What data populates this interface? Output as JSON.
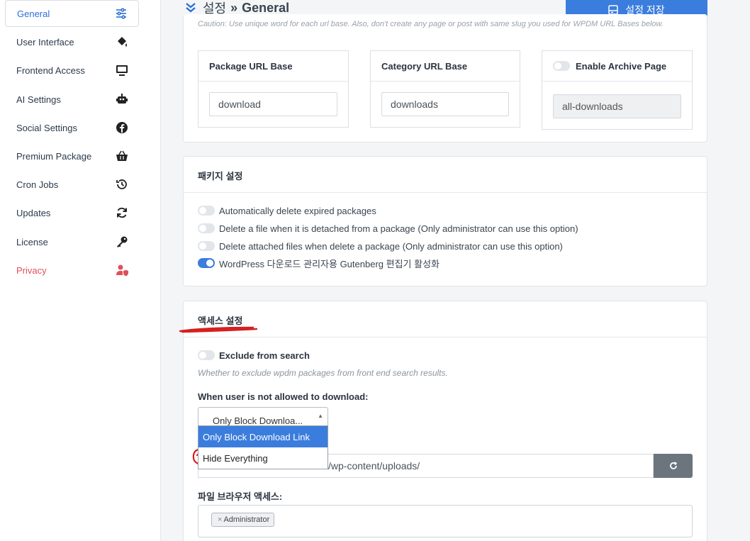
{
  "sidebar": {
    "items": [
      {
        "label": "General",
        "icon": "sliders-icon"
      },
      {
        "label": "User Interface",
        "icon": "paint-bucket-icon"
      },
      {
        "label": "Frontend Access",
        "icon": "monitor-icon"
      },
      {
        "label": "AI Settings",
        "icon": "robot-icon"
      },
      {
        "label": "Social Settings",
        "icon": "facebook-icon"
      },
      {
        "label": "Premium Package",
        "icon": "basket-icon"
      },
      {
        "label": "Cron Jobs",
        "icon": "history-icon"
      },
      {
        "label": "Updates",
        "icon": "sync-icon"
      },
      {
        "label": "License",
        "icon": "key-icon"
      },
      {
        "label": "Privacy",
        "icon": "user-shield-icon"
      }
    ]
  },
  "header": {
    "crumb": "설정",
    "separator": "»",
    "title": "General",
    "save_label": "설정 저장"
  },
  "url_section": {
    "caution": "Caution: Use unique word for each url base. Also, don't create any page or post with same slug you used for WPDM URL Bases below.",
    "package_label": "Package URL Base",
    "package_value": "download",
    "category_label": "Category URL Base",
    "category_value": "downloads",
    "archive_label": "Enable Archive Page",
    "archive_value": "all-downloads"
  },
  "package_settings": {
    "title": "패키지 설정",
    "options": [
      {
        "label": "Automatically delete expired packages",
        "on": false
      },
      {
        "label": "Delete a file when it is detached from a package (Only administrator can use this option)",
        "on": false
      },
      {
        "label": "Delete attached files when delete a package (Only administrator can use this option)",
        "on": false
      },
      {
        "label": "WordPress 다운로드 관리자용 Gutenberg 편집기 활성화",
        "on": true
      }
    ]
  },
  "access_settings": {
    "title": "액세스 설정",
    "exclude_label": "Exclude from search",
    "exclude_help": "Whether to exclude wpdm packages from front end search results.",
    "not_allowed_label": "When user is not allowed to download:",
    "select_value": "Only Block Downloa...",
    "dropdown_options": [
      "Only Block Download Link",
      "Hide Everything"
    ],
    "path_value": "/wp-content/uploads/",
    "file_browser_label": "파일 브라우저 액세스:",
    "tag": "Administrator",
    "tag_remove": "×"
  },
  "colors": {
    "accent": "#3b7ddd",
    "privacy": "#e0505a",
    "annotation": "#d62020"
  }
}
